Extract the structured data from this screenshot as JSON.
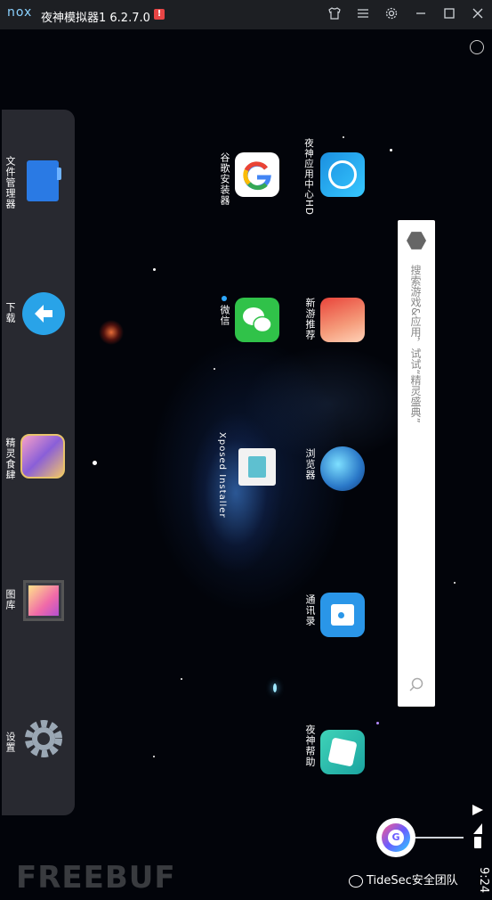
{
  "titlebar": {
    "logo": "nox",
    "title": "夜神模拟器1 6.2.7.0",
    "badge": "!"
  },
  "dock": {
    "items": [
      {
        "label": "文件管理器",
        "icon": "folder-icon"
      },
      {
        "label": "下载",
        "icon": "download-icon"
      },
      {
        "label": "精灵食肆",
        "icon": "game-icon"
      },
      {
        "label": "图库",
        "icon": "gallery-icon"
      },
      {
        "label": "设置",
        "icon": "gear-icon"
      }
    ]
  },
  "apps": [
    {
      "label": "夜神应用中心HD",
      "icon": "nox-store-icon"
    },
    {
      "label": "谷歌安装器",
      "icon": "google-icon"
    },
    {
      "label": "新游推荐",
      "icon": "game-recommend-icon"
    },
    {
      "label": "微信",
      "icon": "wechat-icon"
    },
    {
      "label": "浏览器",
      "icon": "browser-icon"
    },
    {
      "label": "Xposed Installer",
      "icon": "xposed-icon"
    },
    {
      "label": "通讯录",
      "icon": "contacts-icon"
    },
    {
      "label": "夜神帮助",
      "icon": "help-icon"
    }
  ],
  "search": {
    "placeholder": "搜索游戏&应用，试试“精灵盛典”"
  },
  "status": {
    "time": "9:24"
  },
  "watermark": {
    "left": "FREEBUF",
    "right": "TideSec安全团队"
  },
  "colors": {
    "titlebar": "#1d1f23",
    "dock": "#2d2f36",
    "accent": "#2196f3"
  }
}
